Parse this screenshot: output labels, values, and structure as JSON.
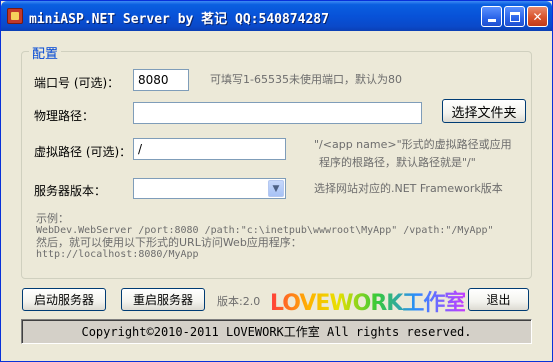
{
  "window": {
    "title": "miniASP.NET Server by 茗记 QQ:540874287"
  },
  "config": {
    "legend": "配置",
    "port": {
      "label": "端口号 (可选)：",
      "value": "8080",
      "hint": "可填写1-65535未使用端口，默认为80"
    },
    "physical_path": {
      "label": "物理路径：",
      "value": "",
      "browse_button": "选择文件夹"
    },
    "virtual_path": {
      "label": "虚拟路径 (可选)：",
      "value": "/",
      "hint_line1": "\"/<app name>\"形式的虚拟路径或应用",
      "hint_line2": "程序的根路径，默认路径就是\"/\""
    },
    "server_version": {
      "label": "服务器版本：",
      "value": "",
      "hint": "选择网站对应的.NET Framework版本"
    },
    "example": {
      "title": "示例：",
      "command": "WebDev.WebServer /port:8080 /path:\"c:\\inetpub\\wwwroot\\MyApp\" /vpath:\"/MyApp\"",
      "note": "然后，就可以使用以下形式的URL访问Web应用程序：",
      "url": "http://localhost:8080/MyApp"
    }
  },
  "footer": {
    "start_button": "启动服务器",
    "restart_button": "重启服务器",
    "version": "版本:2.0",
    "logo_text": "LOVEWORK工作室",
    "exit_button": "退出",
    "copyright": "Copyright©2010-2011 LOVEWORK工作室 All rights reserved."
  }
}
